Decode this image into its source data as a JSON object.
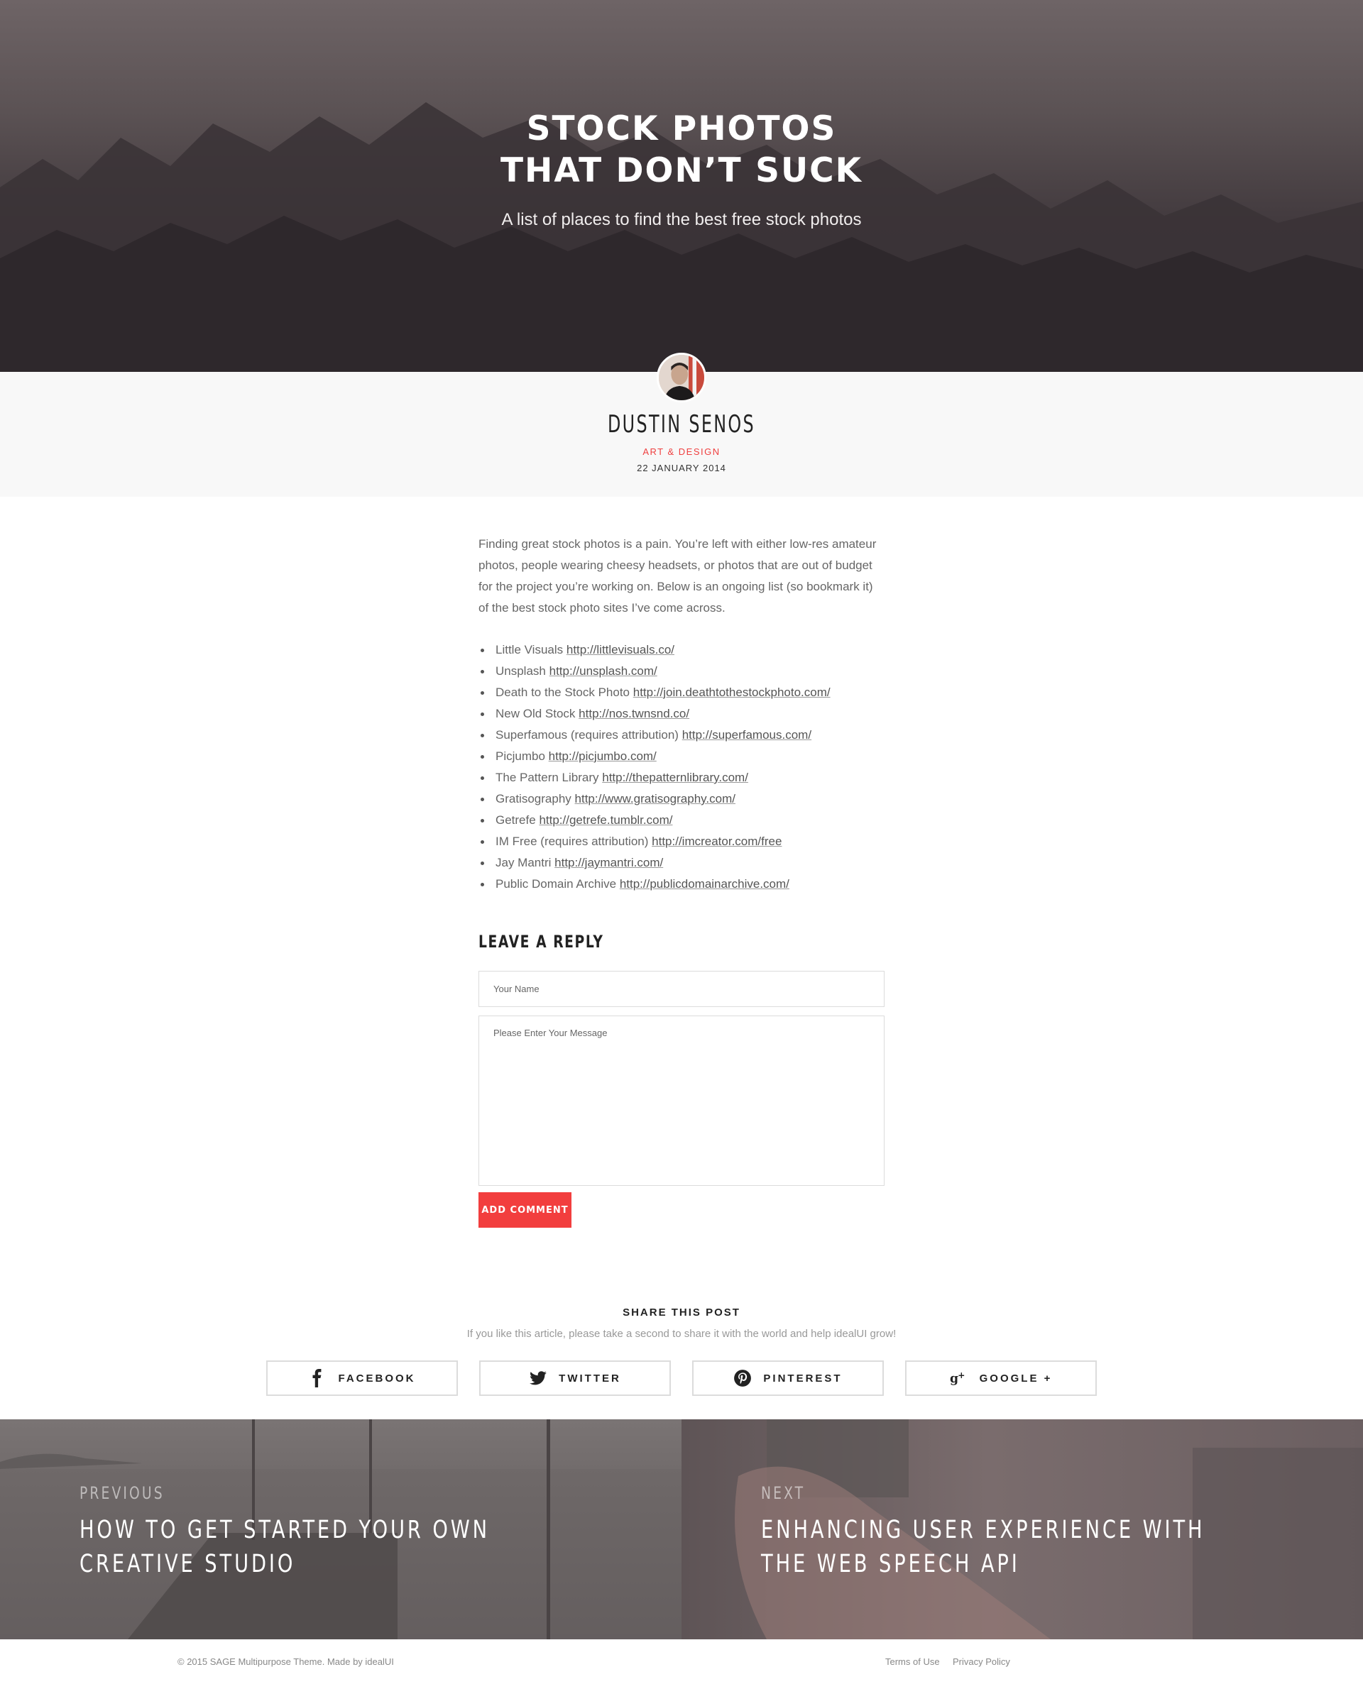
{
  "hero": {
    "title_line1": "STOCK PHOTOS",
    "title_line2": "THAT DON’T SUCK",
    "subtitle": "A list of places to find the best free stock photos"
  },
  "author": {
    "name": "DUSTIN SENOS",
    "category": "ART & DESIGN",
    "date": "22 JANUARY 2014"
  },
  "article": {
    "intro": "Finding great stock photos is a pain. You’re left with either low-res amateur photos, people wearing cheesy headsets, or photos that are out of budget for the project you’re working on. Below is an ongoing list (so bookmark it) of the best stock photo sites I’ve come across.",
    "links": [
      {
        "name": "Little Visuals",
        "url": "http://littlevisuals.co/"
      },
      {
        "name": "Unsplash",
        "url": "http://unsplash.com/"
      },
      {
        "name": "Death to the Stock Photo",
        "url": "http://join.deathtothestockphoto.com/"
      },
      {
        "name": "New Old Stock",
        "url": "http://nos.twnsnd.co/"
      },
      {
        "name": "Superfamous (requires attribution)",
        "url": "http://superfamous.com/"
      },
      {
        "name": "Picjumbo",
        "url": "http://picjumbo.com/"
      },
      {
        "name": "The Pattern Library",
        "url": "http://thepatternlibrary.com/"
      },
      {
        "name": "Gratisography",
        "url": "http://www.gratisography.com/"
      },
      {
        "name": "Getrefe",
        "url": "http://getrefe.tumblr.com/"
      },
      {
        "name": "IM Free (requires attribution)",
        "url": "http://imcreator.com/free"
      },
      {
        "name": "Jay Mantri",
        "url": "http://jaymantri.com/"
      },
      {
        "name": "Public Domain Archive",
        "url": "http://publicdomainarchive.com/"
      }
    ]
  },
  "reply": {
    "title": "LEAVE A REPLY",
    "name_placeholder": "Your Name",
    "message_placeholder": "Please Enter Your Message",
    "submit_label": "ADD COMMENT"
  },
  "share": {
    "title": "SHARE THIS POST",
    "subtitle": "If you like this article, please take a second to share it with the world and help idealUI grow!",
    "buttons": [
      {
        "label": "FACEBOOK",
        "icon": "facebook-icon"
      },
      {
        "label": "TWITTER",
        "icon": "twitter-icon"
      },
      {
        "label": "PINTEREST",
        "icon": "pinterest-icon"
      },
      {
        "label": "GOOGLE +",
        "icon": "google-plus-icon"
      }
    ]
  },
  "nav": {
    "prev_label": "PREVIOUS",
    "prev_title": "HOW TO GET STARTED YOUR OWN CREATIVE STUDIO",
    "next_label": "NEXT",
    "next_title": "ENHANCING USER EXPERIENCE WITH THE WEB SPEECH API"
  },
  "footer": {
    "copyright": "© 2015 SAGE Multipurpose Theme. Made by idealUI",
    "terms": "Terms of Use",
    "privacy": "Privacy Policy"
  },
  "colors": {
    "accent": "#f23e3e",
    "hero_overlay": "#4a4145"
  }
}
